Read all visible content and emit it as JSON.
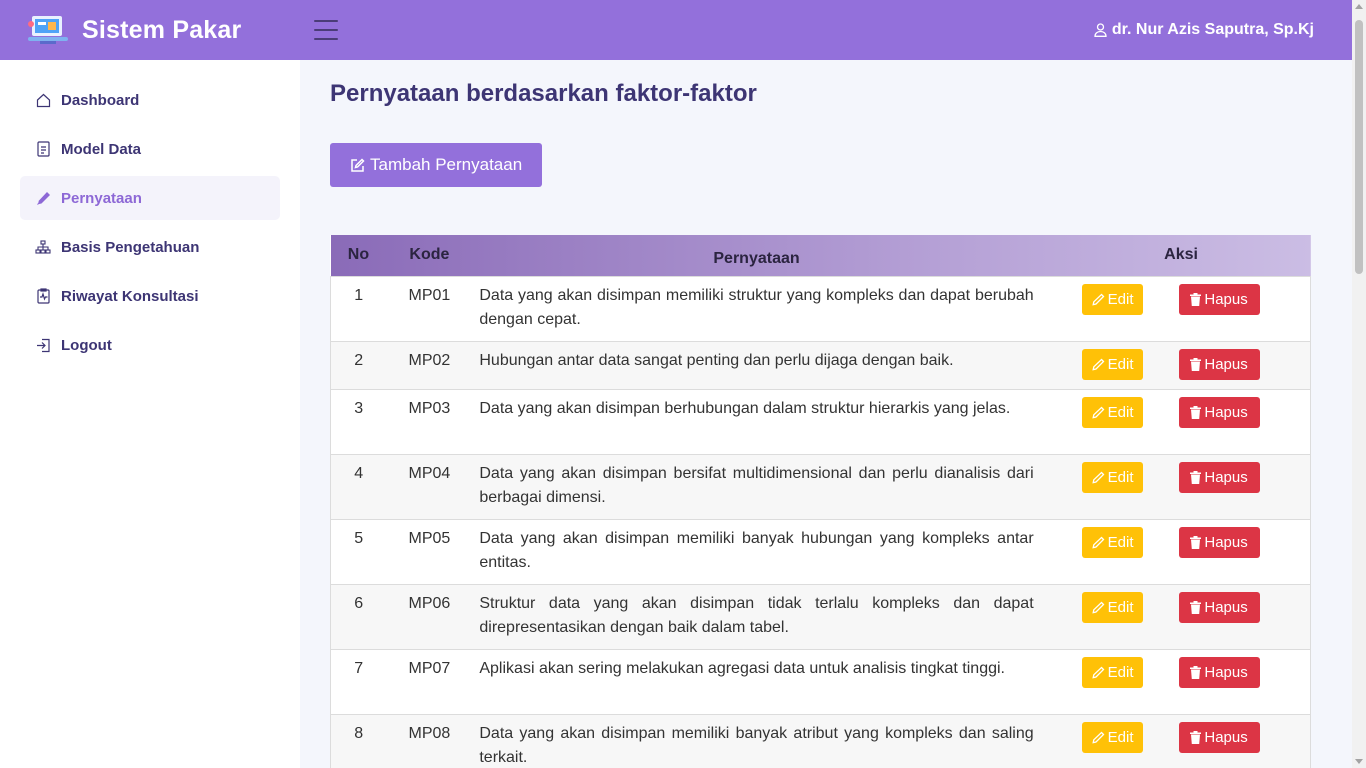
{
  "header": {
    "brand": "Sistem Pakar",
    "user_name": "dr. Nur Azis Saputra, Sp.Kj"
  },
  "sidebar": {
    "items": [
      {
        "label": "Dashboard",
        "icon": "home-icon"
      },
      {
        "label": "Model Data",
        "icon": "document-icon"
      },
      {
        "label": "Pernyataan",
        "icon": "pencil-icon",
        "active": true
      },
      {
        "label": "Basis Pengetahuan",
        "icon": "hierarchy-icon"
      },
      {
        "label": "Riwayat Konsultasi",
        "icon": "clipboard-pulse-icon"
      },
      {
        "label": "Logout",
        "icon": "logout-icon"
      }
    ]
  },
  "main": {
    "title": "Pernyataan berdasarkan faktor-faktor",
    "add_button": "Tambah Pernyataan",
    "table": {
      "headers": {
        "no": "No",
        "kode": "Kode",
        "pernyataan": "Pernyataan",
        "aksi": "Aksi"
      },
      "edit_label": "Edit",
      "delete_label": "Hapus",
      "rows": [
        {
          "no": "1",
          "kode": "MP01",
          "text": "Data yang akan disimpan memiliki struktur yang kompleks dan dapat berubah dengan cepat."
        },
        {
          "no": "2",
          "kode": "MP02",
          "text": "Hubungan antar data sangat penting dan perlu dijaga dengan baik."
        },
        {
          "no": "3",
          "kode": "MP03",
          "text": "Data yang akan disimpan berhubungan dalam struktur hierarkis yang jelas."
        },
        {
          "no": "4",
          "kode": "MP04",
          "text": "Data yang akan disimpan bersifat multidimensional dan perlu dianalisis dari berbagai dimensi."
        },
        {
          "no": "5",
          "kode": "MP05",
          "text": "Data yang akan disimpan memiliki banyak hubungan yang kompleks antar entitas."
        },
        {
          "no": "6",
          "kode": "MP06",
          "text": "Struktur data yang akan disimpan tidak terlalu kompleks dan dapat direpresentasikan dengan baik dalam tabel."
        },
        {
          "no": "7",
          "kode": "MP07",
          "text": "Aplikasi akan sering melakukan agregasi data untuk analisis tingkat tinggi."
        },
        {
          "no": "8",
          "kode": "MP08",
          "text": "Data yang akan disimpan memiliki banyak atribut yang kompleks dan saling terkait."
        }
      ]
    }
  },
  "colors": {
    "primary": "#9370db",
    "nav_text": "#3d3574",
    "edit": "#ffc107",
    "delete": "#dc3545"
  }
}
